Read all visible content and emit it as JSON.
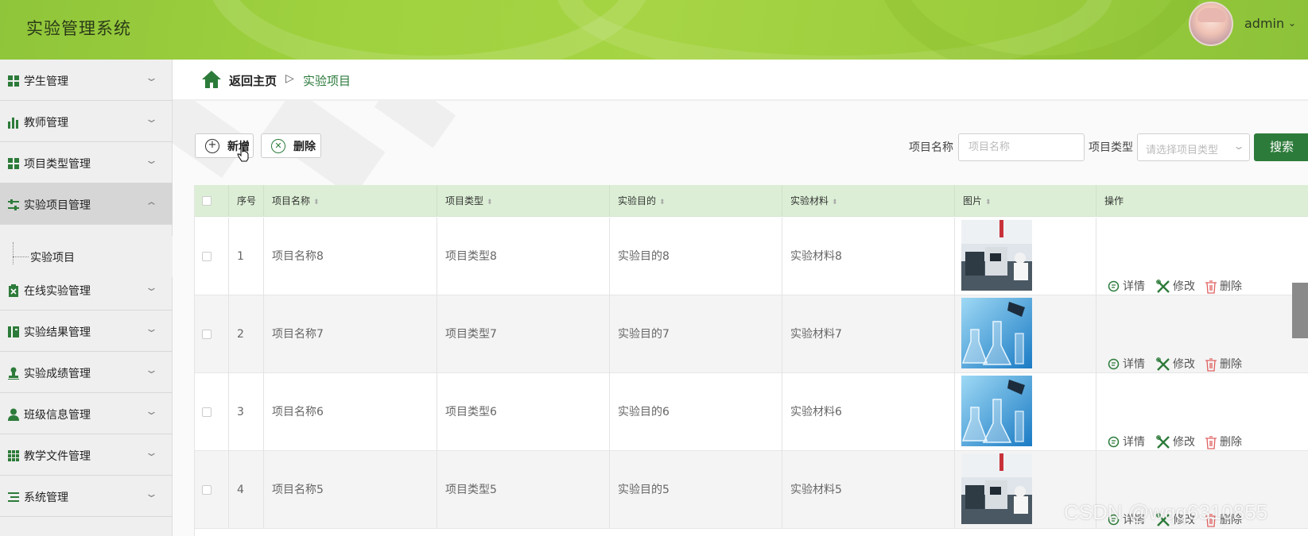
{
  "header": {
    "app_title": "实验管理系统",
    "user_name": "admin",
    "user_caret": "⌄"
  },
  "sidebar": {
    "items": [
      {
        "label": "学生管理",
        "icon": "grid-icon",
        "expanded": false
      },
      {
        "label": "教师管理",
        "icon": "bar-chart-icon",
        "expanded": false
      },
      {
        "label": "项目类型管理",
        "icon": "grid-icon",
        "expanded": false
      },
      {
        "label": "实验项目管理",
        "icon": "sliders-icon",
        "expanded": true
      },
      {
        "label": "在线实验管理",
        "icon": "clipboard-icon",
        "expanded": false
      },
      {
        "label": "实验结果管理",
        "icon": "book-icon",
        "expanded": false
      },
      {
        "label": "实验成绩管理",
        "icon": "stamp-icon",
        "expanded": false
      },
      {
        "label": "班级信息管理",
        "icon": "user-icon",
        "expanded": false
      },
      {
        "label": "教学文件管理",
        "icon": "apps-icon",
        "expanded": false
      },
      {
        "label": "系统管理",
        "icon": "list-icon",
        "expanded": false
      }
    ],
    "submenu": {
      "label": "实验项目"
    }
  },
  "breadcrumb": {
    "home": "返回主页",
    "separator": "▷",
    "current": "实验项目"
  },
  "toolbar": {
    "add_label": "新增",
    "delete_label": "删除"
  },
  "search": {
    "name_label": "项目名称",
    "name_placeholder": "项目名称",
    "type_label": "项目类型",
    "type_placeholder": "请选择项目类型",
    "button": "搜索"
  },
  "table": {
    "columns": [
      "序号",
      "项目名称",
      "项目类型",
      "实验目的",
      "实验材料",
      "图片",
      "操作"
    ],
    "actions": {
      "detail": "详情",
      "edit": "修改",
      "delete": "删除"
    },
    "rows": [
      {
        "index": "1",
        "name": "项目名称8",
        "type": "项目类型8",
        "purpose": "实验目的8",
        "material": "实验材料8",
        "image": "lab-photo"
      },
      {
        "index": "2",
        "name": "项目名称7",
        "type": "项目类型7",
        "purpose": "实验目的7",
        "material": "实验材料7",
        "image": "flask-photo"
      },
      {
        "index": "3",
        "name": "项目名称6",
        "type": "项目类型6",
        "purpose": "实验目的6",
        "material": "实验材料6",
        "image": "flask-photo"
      },
      {
        "index": "4",
        "name": "项目名称5",
        "type": "项目类型5",
        "purpose": "实验目的5",
        "material": "实验材料5",
        "image": "lab-photo"
      }
    ]
  },
  "watermark": "CSDN @wqq6310855",
  "colors": {
    "header_green": "#9fd13e",
    "primary_green": "#2d7b3a",
    "table_header": "#dcefd6",
    "delete_red": "#e06060"
  }
}
